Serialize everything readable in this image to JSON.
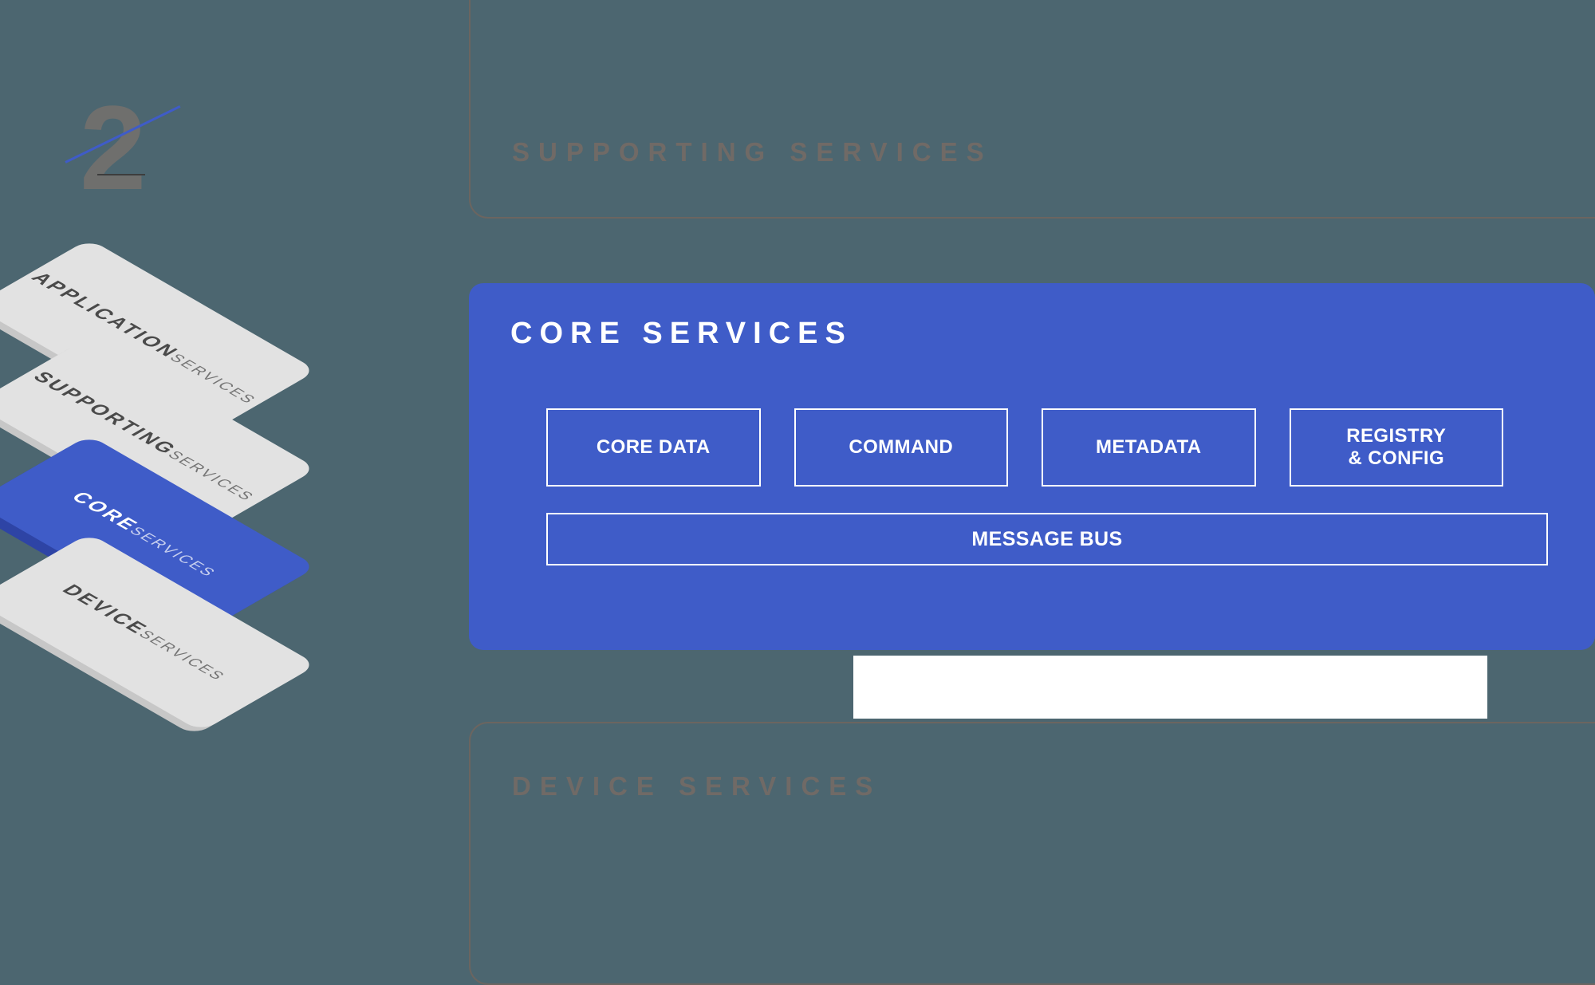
{
  "step": {
    "number": "2"
  },
  "stack": {
    "layers": [
      {
        "main": "APPLICATION",
        "sub": "SERVICES",
        "color": "#e2e2e2",
        "highlighted": false
      },
      {
        "main": "SUPPORTING",
        "sub": "SERVICES",
        "color": "#e2e2e2",
        "highlighted": false
      },
      {
        "main": "CORE",
        "sub": "SERVICES",
        "color": "#3f5cc8",
        "highlighted": true
      },
      {
        "main": "DEVICE",
        "sub": "SERVICES",
        "color": "#e2e2e2",
        "highlighted": false
      }
    ]
  },
  "supporting": {
    "title": "SUPPORTING SERVICES"
  },
  "device": {
    "title": "DEVICE SERVICES"
  },
  "core": {
    "title": "CORE SERVICES",
    "accent_color": "#3f5cc8",
    "boxes": [
      {
        "label": "CORE DATA"
      },
      {
        "label": "COMMAND"
      },
      {
        "label": "METADATA"
      },
      {
        "label": "REGISTRY\n& CONFIG"
      }
    ],
    "database_icon": "database-icon",
    "message_bus": "MESSAGE BUS"
  },
  "colors": {
    "background": "#4c6670",
    "accent": "#3f5cc8",
    "muted_text": "#706a66",
    "slab_gray": "#e2e2e2"
  }
}
